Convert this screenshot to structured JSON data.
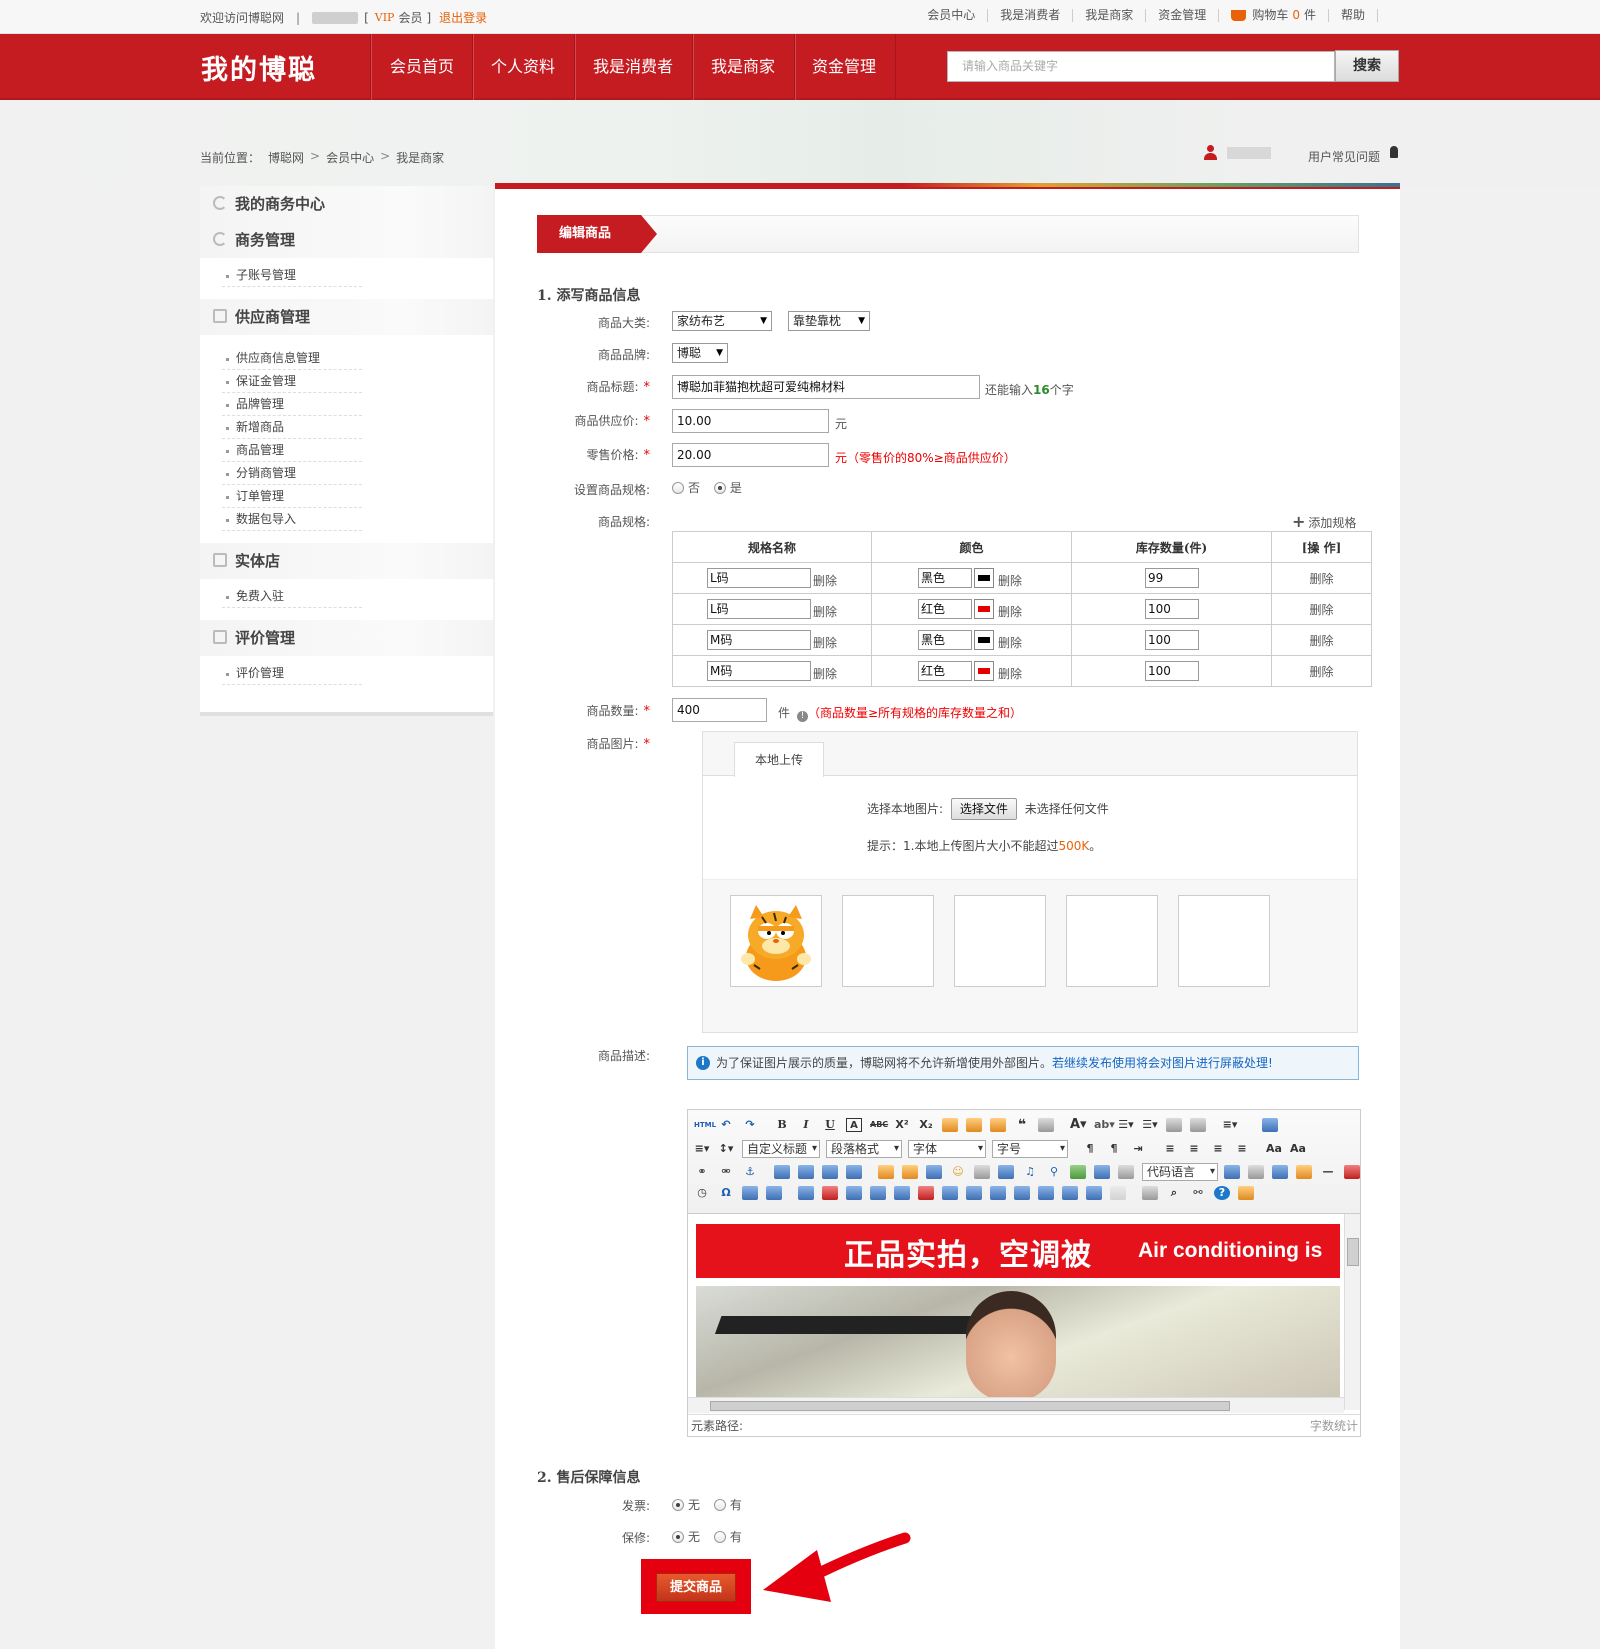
{
  "topbar": {
    "welcome": "欢迎访问博聪网",
    "bracket_open": "[",
    "vip": "VIP",
    "member": "会员",
    "bracket_close": "]",
    "logout": "退出登录",
    "links": [
      "会员中心",
      "我是消费者",
      "我是商家",
      "资金管理"
    ],
    "cart_label": "购物车",
    "cart_count": "0",
    "cart_unit": "件",
    "help": "帮助"
  },
  "header": {
    "brand": "我的博聪",
    "nav": [
      "会员首页",
      "个人资料",
      "我是消费者",
      "我是商家",
      "资金管理"
    ],
    "search_placeholder": "请输入商品关键字",
    "search_button": "搜索"
  },
  "breadcrumb": {
    "label": "当前位置：",
    "items": [
      "博聪网",
      "会员中心",
      "我是商家"
    ],
    "faq": "用户常见问题"
  },
  "sidebar": {
    "center_title": "我的商务中心",
    "groups": [
      {
        "title": "商务管理",
        "items": [
          "子账号管理"
        ]
      },
      {
        "title": "供应商管理",
        "items": [
          "供应商信息管理",
          "保证金管理",
          "品牌管理",
          "新增商品",
          "商品管理",
          "分销商管理",
          "订单管理",
          "数据包导入"
        ]
      },
      {
        "title": "实体店",
        "items": [
          "免费入驻"
        ]
      },
      {
        "title": "评价管理",
        "items": [
          "评价管理"
        ]
      }
    ]
  },
  "main": {
    "tab_title": "编辑商品",
    "section1": "1. 添写商品信息",
    "category_label": "商品大类:",
    "category_1": "家纺布艺",
    "category_2": "靠垫靠枕",
    "brand_label": "商品品牌:",
    "brand_value": "博聪",
    "title_label": "商品标题:",
    "title_value": "博聪加菲猫抱枕超可爱纯棉材料",
    "title_hint_pre": "还能输入",
    "title_hint_num": "16",
    "title_hint_post": "个字",
    "supply_label": "商品供应价:",
    "supply_value": "10.00",
    "yuan": "元",
    "retail_label": "零售价格:",
    "retail_value": "20.00",
    "retail_hint": "元（零售价的80%≥商品供应价）",
    "spec_set_label": "设置商品规格:",
    "spec_no": "否",
    "spec_yes": "是",
    "spec_label": "商品规格:",
    "add_spec": "添加规格",
    "spec_headers": [
      "规格名称",
      "颜色",
      "库存数量(件)",
      "[操  作]"
    ],
    "delete": "删除",
    "spec_rows": [
      {
        "name": "L码",
        "color": "黑色",
        "swatch": "#000000",
        "stock": "99"
      },
      {
        "name": "L码",
        "color": "红色",
        "swatch": "#e00000",
        "stock": "100"
      },
      {
        "name": "M码",
        "color": "黑色",
        "swatch": "#000000",
        "stock": "100"
      },
      {
        "name": "M码",
        "color": "红色",
        "swatch": "#e00000",
        "stock": "100"
      }
    ],
    "qty_label": "商品数量:",
    "qty_value": "400",
    "qty_unit": "件",
    "qty_hint": "（商品数量≥所有规格的库存数量之和）",
    "image_label": "商品图片:",
    "upload_tab": "本地上传",
    "upload_choose": "选择本地图片:",
    "upload_button": "选择文件",
    "upload_none": "未选择任何文件",
    "upload_tip_pre": "提示：1.本地上传图片大小不能超过",
    "upload_tip_size": "500K",
    "upload_tip_post": "。",
    "desc_label": "商品描述:",
    "notice_text": "为了保证图片展示的质量，博聪网将不允许新增使用外部图片。",
    "notice_blue": "若继续发布使用将会对图片进行屏蔽处理!",
    "toolbar_selects": [
      "自定义标题",
      "段落格式",
      "字体",
      "字号",
      "代码语言"
    ],
    "promo_cn": "正品实拍，空调被",
    "promo_en": "Air conditioning is",
    "status_path": "元素路径:",
    "word_count": "字数统计",
    "section2": "2. 售后保障信息",
    "invoice_label": "发票:",
    "warranty_label": "保修:",
    "opt_none": "无",
    "opt_have": "有",
    "submit": "提交商品"
  },
  "colors": {
    "brand_red": "#c51c22",
    "accent_orange": "#e8620a"
  }
}
